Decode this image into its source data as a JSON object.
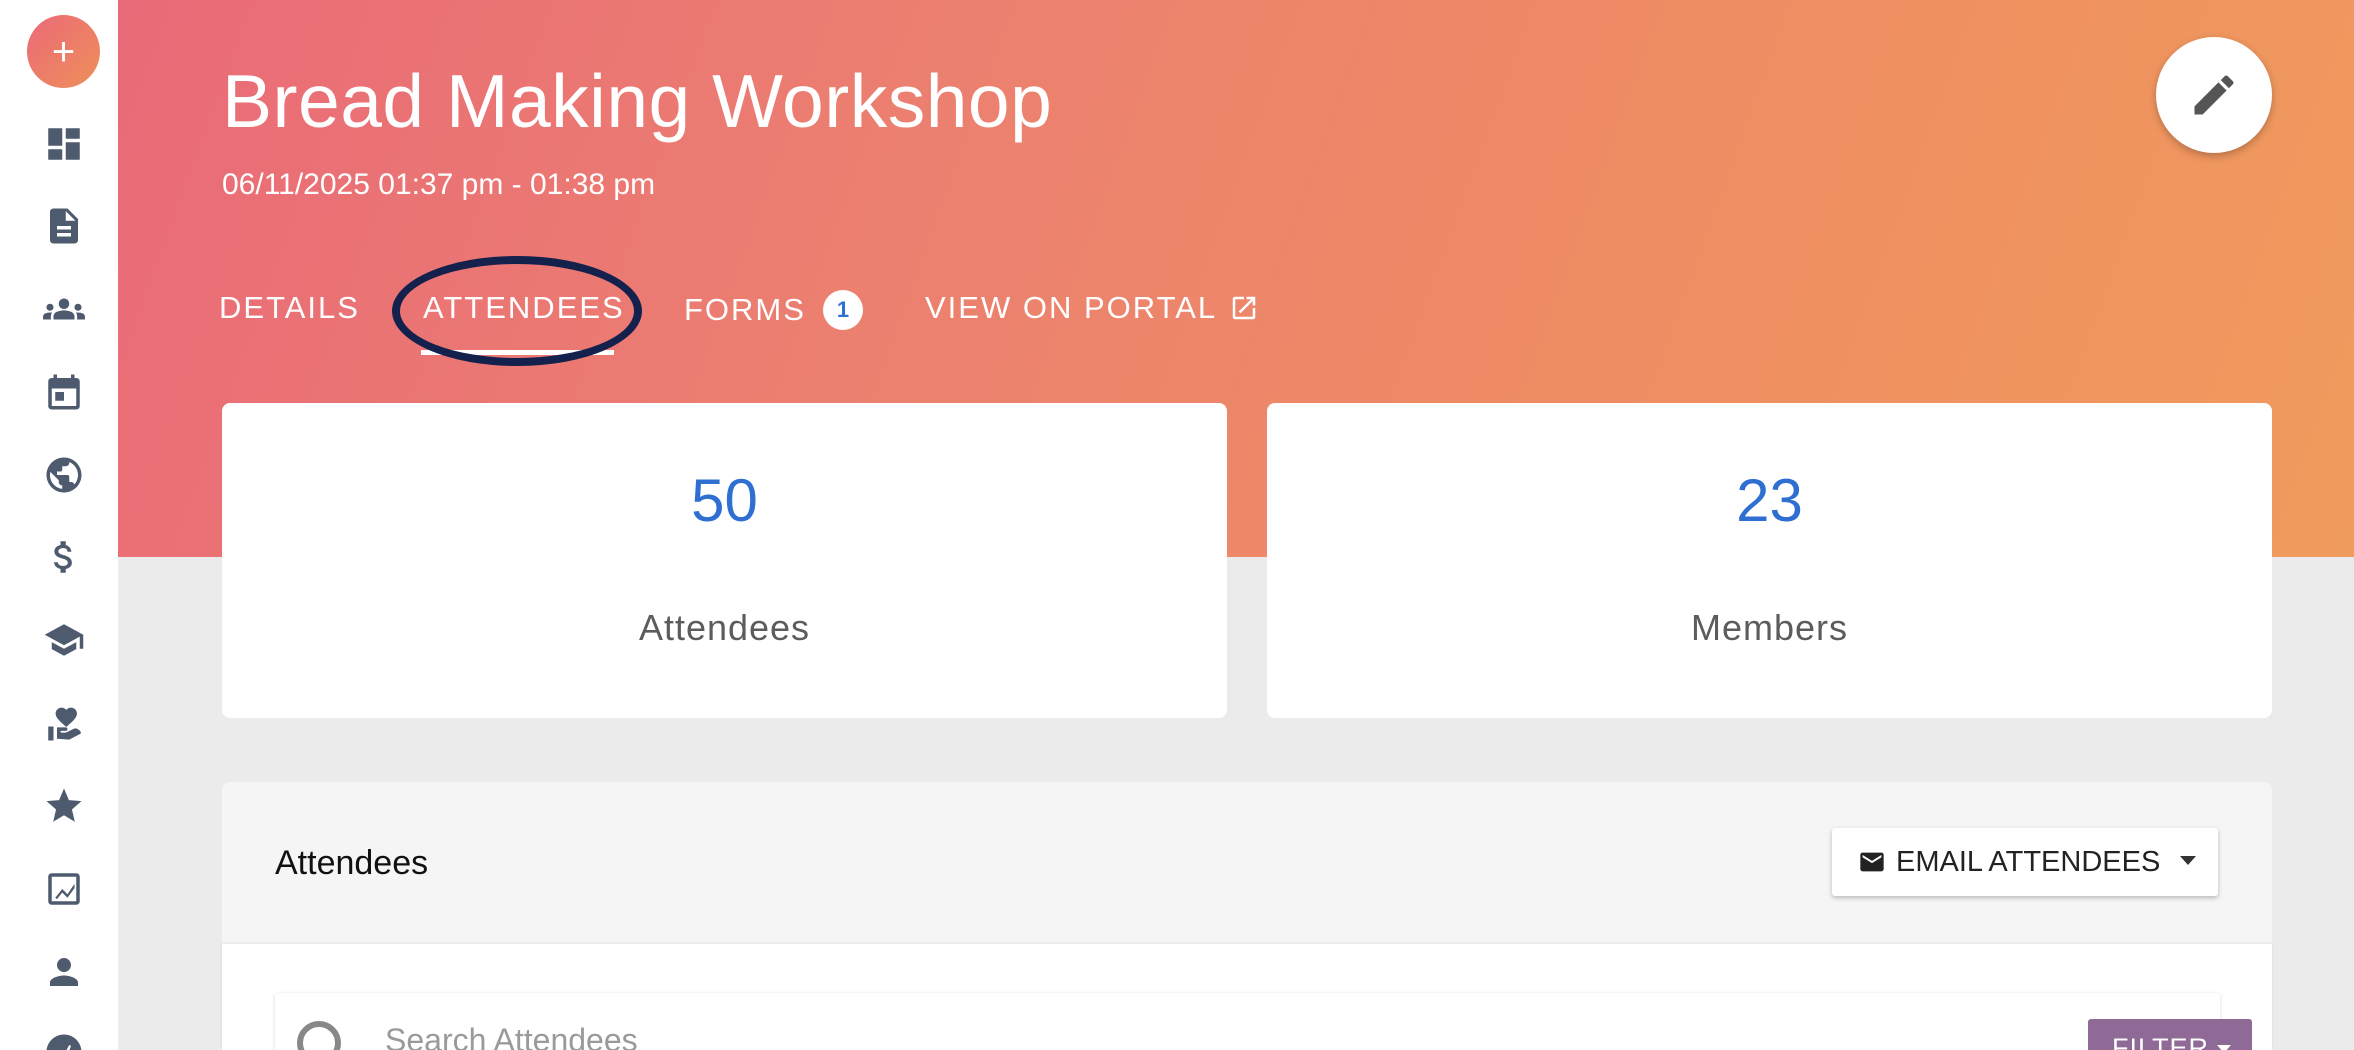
{
  "sidebar": {
    "add_label": "+",
    "items": [
      {
        "icon": "dashboard-icon"
      },
      {
        "icon": "document-icon"
      },
      {
        "icon": "groups-icon"
      },
      {
        "icon": "calendar-icon"
      },
      {
        "icon": "globe-icon"
      },
      {
        "icon": "dollar-icon"
      },
      {
        "icon": "graduation-cap-icon"
      },
      {
        "icon": "heart-hand-icon"
      },
      {
        "icon": "star-icon"
      },
      {
        "icon": "chart-icon"
      },
      {
        "icon": "person-icon"
      },
      {
        "icon": "gauge-icon"
      }
    ]
  },
  "event": {
    "title": "Bread Making Workshop",
    "datetime": "06/11/2025 01:37 pm - 01:38 pm"
  },
  "tabs": [
    {
      "label": "DETAILS"
    },
    {
      "label": "ATTENDEES",
      "active": true
    },
    {
      "label": "FORMS",
      "badge": "1"
    },
    {
      "label": "VIEW ON PORTAL"
    }
  ],
  "stats": {
    "attendees": {
      "value": "50",
      "label": "Attendees"
    },
    "members": {
      "value": "23",
      "label": "Members"
    }
  },
  "panel": {
    "title": "Attendees",
    "email_button": "EMAIL ATTENDEES",
    "search_placeholder": "Search Attendees",
    "filter_button": "FILTER"
  },
  "colors": {
    "accent_blue": "#2e6fd1",
    "gradient_start": "#e96a78",
    "gradient_end": "#f09b5e",
    "filter_purple": "#8f6a96",
    "annotation_navy": "#14214c"
  }
}
